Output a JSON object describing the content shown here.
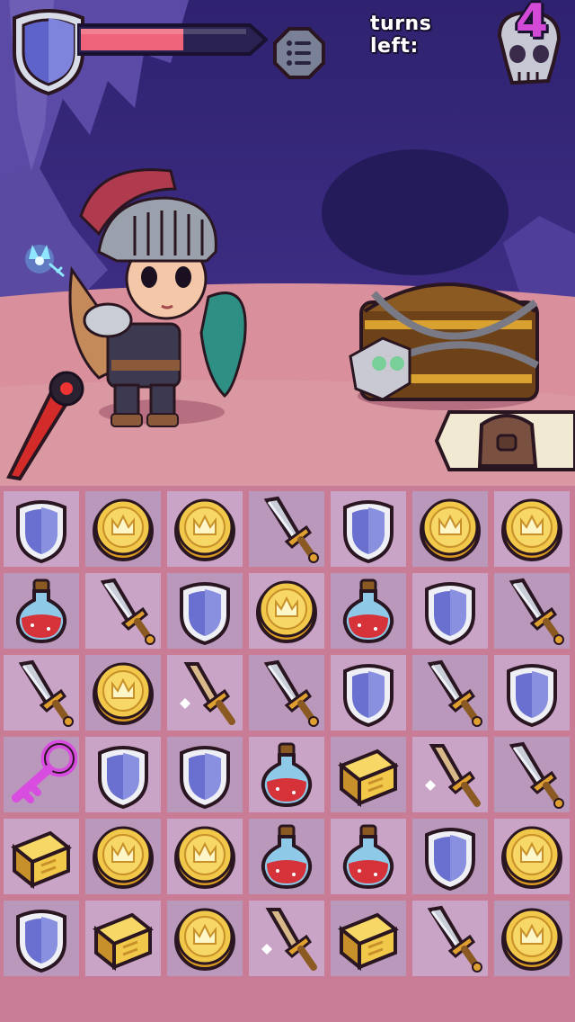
{
  "hud": {
    "turns_label": "turns left:",
    "turns_count": "4",
    "health_fraction": 0.62,
    "menu_icon": "list-icon"
  },
  "scene": {
    "hero": "knight-hero",
    "companion": "fairy",
    "chest": "locked-treasure-chest",
    "loot_slot": "bag-icon"
  },
  "board": {
    "rows": 6,
    "cols": 7,
    "tiles": [
      [
        "shield",
        "coin",
        "coin",
        "sword",
        "shield",
        "coin",
        "coin"
      ],
      [
        "potion",
        "sword",
        "shield",
        "coin",
        "potion",
        "shield",
        "sword"
      ],
      [
        "sword",
        "coin",
        "wood-sword",
        "sword",
        "shield",
        "sword",
        "shield"
      ],
      [
        "key",
        "shield",
        "shield",
        "potion",
        "gold-bar",
        "wood-sword",
        "sword"
      ],
      [
        "gold-bar",
        "coin",
        "coin",
        "potion",
        "potion",
        "shield",
        "coin"
      ],
      [
        "shield",
        "gold-bar",
        "coin",
        "wood-sword",
        "gold-bar",
        "sword",
        "coin"
      ]
    ]
  },
  "colors": {
    "health": "#ef6478",
    "sky": "#3a2a86",
    "ground": "#d9909c",
    "board_bg": "#c87c96",
    "turns_count": "#d24ad6"
  }
}
